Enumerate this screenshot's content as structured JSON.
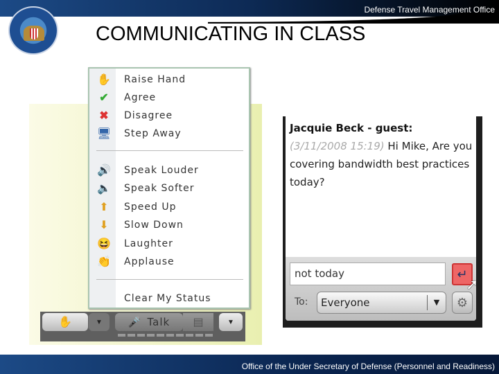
{
  "header": {
    "org": "Defense Travel Management Office",
    "title": "COMMUNICATING IN CLASS",
    "logo_text": "Defense Travel Management Office seal"
  },
  "status_menu": {
    "items": [
      {
        "label": "Raise Hand",
        "icon": "raise-hand-icon"
      },
      {
        "label": "Agree",
        "icon": "checkmark-icon"
      },
      {
        "label": "Disagree",
        "icon": "x-icon"
      },
      {
        "label": "Step Away",
        "icon": "monitor-icon"
      },
      {
        "label": "Speak Louder",
        "icon": "speaker-loud-icon"
      },
      {
        "label": "Speak Softer",
        "icon": "speaker-soft-icon"
      },
      {
        "label": "Speed Up",
        "icon": "arrow-up-icon"
      },
      {
        "label": "Slow Down",
        "icon": "arrow-down-icon"
      },
      {
        "label": "Laughter",
        "icon": "laugh-icon"
      },
      {
        "label": "Applause",
        "icon": "applause-icon"
      },
      {
        "label": "Clear My Status",
        "icon": ""
      }
    ]
  },
  "toolbar": {
    "talk_label": "Talk"
  },
  "chat": {
    "sender": "Jacquie Beck - guest:",
    "timestamp": "(3/11/2008 15:19)",
    "message": "Hi Mike, Are you covering bandwidth best practices today?",
    "input_value": "not today",
    "to_label": "To:",
    "recipient": "Everyone"
  },
  "footer": {
    "text": "Office of the Under Secretary of Defense (Personnel and Readiness)"
  },
  "colors": {
    "header_blue": "#1c4a86",
    "send_highlight": "#e66666"
  }
}
